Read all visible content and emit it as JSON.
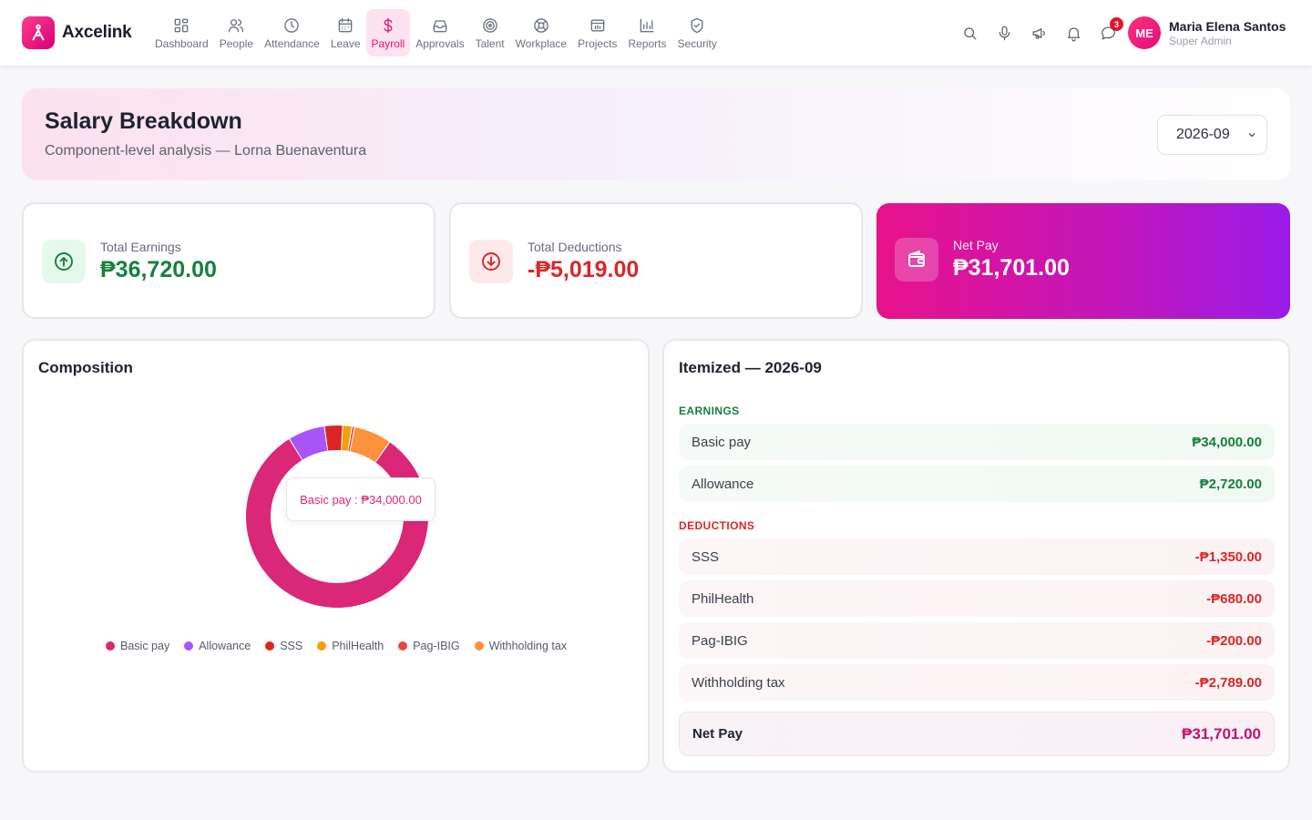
{
  "brand": {
    "name": "Axcelink"
  },
  "nav": [
    {
      "label": "Dashboard",
      "icon": "dashboard-icon",
      "active": false
    },
    {
      "label": "People",
      "icon": "people-icon",
      "active": false
    },
    {
      "label": "Attendance",
      "icon": "clock-icon",
      "active": false
    },
    {
      "label": "Leave",
      "icon": "calendar-icon",
      "active": false
    },
    {
      "label": "Payroll",
      "icon": "dollar-icon",
      "active": true
    },
    {
      "label": "Approvals",
      "icon": "inbox-icon",
      "active": false
    },
    {
      "label": "Talent",
      "icon": "target-icon",
      "active": false
    },
    {
      "label": "Workplace",
      "icon": "lifebuoy-icon",
      "active": false
    },
    {
      "label": "Projects",
      "icon": "folder-icon",
      "active": false
    },
    {
      "label": "Reports",
      "icon": "bar-chart-icon",
      "active": false
    },
    {
      "label": "Security",
      "icon": "shield-icon",
      "active": false
    }
  ],
  "header": {
    "chat_badge": "3",
    "user": {
      "initials": "ME",
      "name": "Maria Elena Santos",
      "role": "Super Admin"
    }
  },
  "hero": {
    "title": "Salary Breakdown",
    "subtitle": "Component-level analysis — Lorna Buenaventura",
    "period": "2026-09"
  },
  "stats": {
    "earnings": {
      "label": "Total Earnings",
      "value": "₱36,720.00"
    },
    "deductions": {
      "label": "Total Deductions",
      "value": "-₱5,019.00"
    },
    "net": {
      "label": "Net Pay",
      "value": "₱31,701.00"
    }
  },
  "composition": {
    "title": "Composition",
    "tooltip": "Basic pay : ₱34,000.00"
  },
  "colors": {
    "accent": "#e0107a",
    "earnings": "#15803d",
    "deductions": "#dc2626"
  },
  "chart_data": {
    "type": "pie",
    "categories": [
      "Basic pay",
      "Allowance",
      "SSS",
      "PhilHealth",
      "Pag-IBIG",
      "Withholding tax"
    ],
    "values": [
      34000,
      2720,
      1350,
      680,
      200,
      2789
    ],
    "colors": [
      "#db2777",
      "#a855f7",
      "#dc2626",
      "#f59e0b",
      "#ef4444",
      "#fb923c"
    ],
    "legend": "bottom"
  },
  "itemized": {
    "title": "Itemized — 2026-09",
    "earnings_label": "EARNINGS",
    "earnings": [
      {
        "label": "Basic pay",
        "amount": "₱34,000.00"
      },
      {
        "label": "Allowance",
        "amount": "₱2,720.00"
      }
    ],
    "deductions_label": "DEDUCTIONS",
    "deductions": [
      {
        "label": "SSS",
        "amount": "-₱1,350.00"
      },
      {
        "label": "PhilHealth",
        "amount": "-₱680.00"
      },
      {
        "label": "Pag-IBIG",
        "amount": "-₱200.00"
      },
      {
        "label": "Withholding tax",
        "amount": "-₱2,789.00"
      }
    ],
    "net": {
      "label": "Net Pay",
      "amount": "₱31,701.00"
    }
  }
}
